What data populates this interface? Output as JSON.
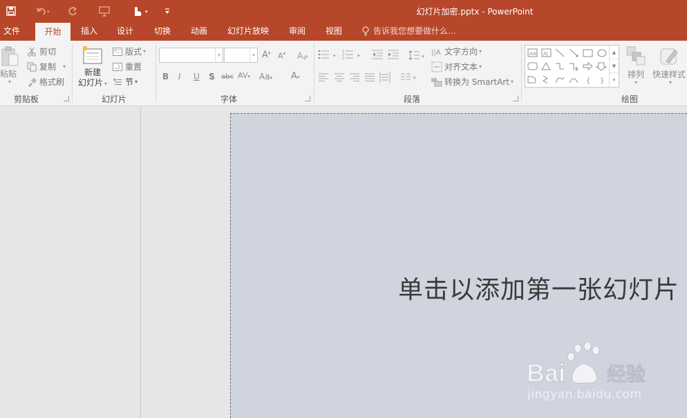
{
  "window": {
    "title": "幻灯片加密.pptx - PowerPoint"
  },
  "tabs": [
    {
      "label": "文件"
    },
    {
      "label": "开始"
    },
    {
      "label": "插入"
    },
    {
      "label": "设计"
    },
    {
      "label": "切换"
    },
    {
      "label": "动画"
    },
    {
      "label": "幻灯片放映"
    },
    {
      "label": "审阅"
    },
    {
      "label": "视图"
    }
  ],
  "tellme": {
    "text": "告诉我您想要做什么..."
  },
  "ribbon": {
    "clipboard": {
      "label": "剪贴板",
      "paste": "粘贴",
      "cut": "剪切",
      "copy": "复制",
      "format_painter": "格式刷"
    },
    "slides": {
      "label": "幻灯片",
      "new_line1": "新建",
      "new_line2": "幻灯片",
      "layout": "版式",
      "reset": "重置",
      "section": "节"
    },
    "font": {
      "label": "字体",
      "bold": "B",
      "italic": "I",
      "underline": "U",
      "shadow": "S",
      "strike": "abc",
      "spacing": "AV",
      "case": "Aa",
      "grow": "A",
      "shrink": "A",
      "color": "A"
    },
    "paragraph": {
      "label": "段落",
      "text_direction": "文字方向",
      "align_text": "对齐文本",
      "smartart": "转换为 SmartArt"
    },
    "drawing": {
      "label": "绘图",
      "arrange": "排列",
      "quick_styles": "快速样式"
    }
  },
  "slide": {
    "placeholder": "单击以添加第一张幻灯片"
  },
  "watermark": {
    "logo_text": "Bai du 经验",
    "url": "jingyan.baidu.com"
  },
  "colors": {
    "accent": "#b7472a",
    "ribbon": "#f3f3f3",
    "slide_bg": "#d0d4de"
  }
}
